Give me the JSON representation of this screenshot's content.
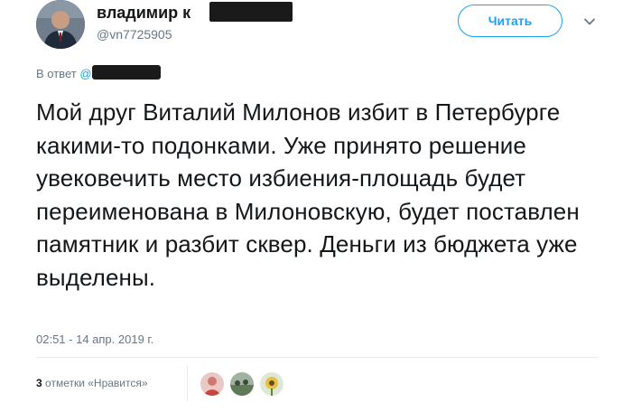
{
  "author": {
    "name": "владимир к",
    "handle": "@vn7725905"
  },
  "follow_button": {
    "label": "Читать"
  },
  "reply_to": {
    "prefix": "В ответ",
    "at": "@"
  },
  "tweet": {
    "text": "Мой друг Виталий Милонов  избит  в Петербурге какими-то подонками. Уже принято решение увековечить место избиения-площадь будет переименована в Милоновскую, будет поставлен памятник и разбит сквер. Деньги из бюджета уже выделены."
  },
  "timestamp": "02:51 - 14 апр. 2019 г.",
  "likes": {
    "count": "3",
    "label": "отметки «Нравится»"
  },
  "colors": {
    "accent": "#1da1f2",
    "muted": "#657786",
    "text": "#14171a"
  },
  "icons": [
    "chevron-down-icon"
  ]
}
